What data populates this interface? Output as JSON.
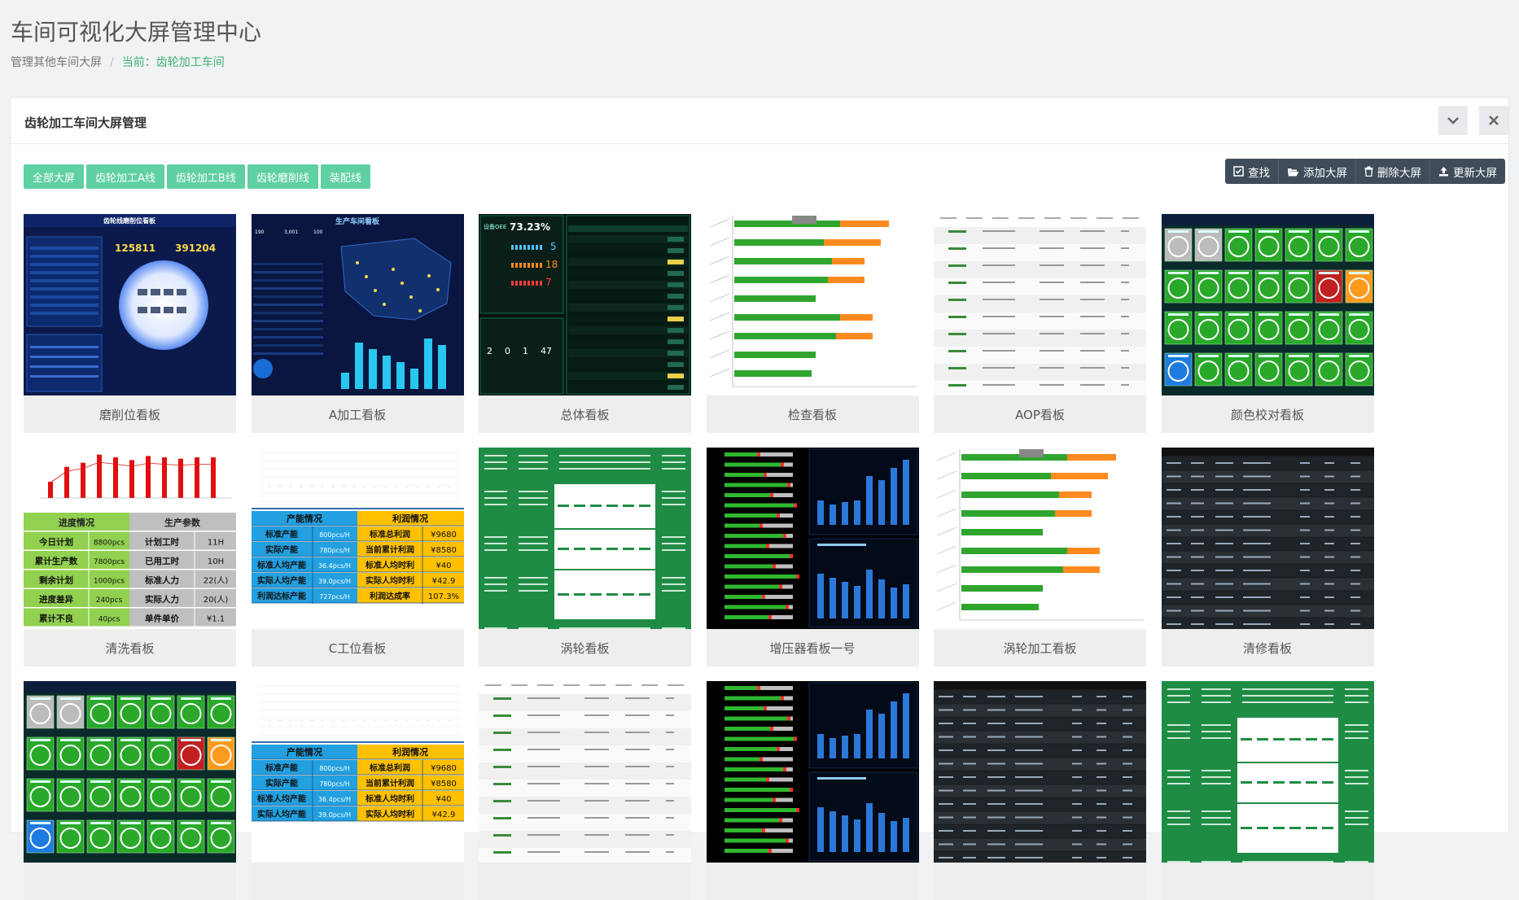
{
  "header": {
    "title": "车间可视化大屏管理中心",
    "breadcrumb": {
      "parent": "管理其他车间大屏",
      "current": "当前：齿轮加工车间"
    }
  },
  "panel": {
    "title": "齿轮加工车间大屏管理",
    "collapse_icon": "chevron-down-icon",
    "close_icon": "close-icon"
  },
  "filters": [
    "全部大屏",
    "齿轮加工A线",
    "齿轮加工B线",
    "齿轮磨削线",
    "装配线"
  ],
  "tools": [
    {
      "label": "查找",
      "icon": "search-check-icon"
    },
    {
      "label": "添加大屏",
      "icon": "folder-open-icon"
    },
    {
      "label": "删除大屏",
      "icon": "trash-icon"
    },
    {
      "label": "更新大屏",
      "icon": "upload-icon"
    }
  ],
  "cards": [
    {
      "label": "磨削位看板",
      "style": "navy-globe",
      "thumb_text": [
        "齿轮线磨削位看板",
        "125811",
        "391204"
      ]
    },
    {
      "label": "A加工看板",
      "style": "navy-map",
      "thumb_text": [
        "生产车间看板",
        "190",
        "3,001",
        "100"
      ]
    },
    {
      "label": "总体看板",
      "style": "black-metrics",
      "thumb_text": [
        "设备OEE",
        "73.23%",
        "5",
        "18",
        "7",
        "2",
        "0",
        "1",
        "47"
      ]
    },
    {
      "label": "检查看板",
      "style": "bars-green-orange",
      "thumb_text": []
    },
    {
      "label": "AOP看板",
      "style": "table-white",
      "thumb_text": []
    },
    {
      "label": "颜色校对看板",
      "style": "green-circles",
      "thumb_text": []
    },
    {
      "label": "清洗看板",
      "style": "qingxi-table",
      "thumb_text": [
        "进度情况",
        "生产参数",
        "今日计划",
        "8800pcs",
        "计划工时",
        "11H",
        "累计生产数",
        "7800pcs",
        "已用工时",
        "10H",
        "剩余计划",
        "1000pcs",
        "标准人力",
        "22(人)",
        "进度差异",
        "240pcs",
        "实际人力",
        "20(人)",
        "累计不良",
        "40pcs",
        "单件单价",
        "¥1.1"
      ]
    },
    {
      "label": "C工位看板",
      "style": "capacity-table",
      "thumb_text": [
        "产能情况",
        "利润情况",
        "标准产能",
        "800pcs/H",
        "标准总利润",
        "¥9680",
        "实际产能",
        "780pcs/H",
        "当前累计利润",
        "¥8580",
        "标准人均产能",
        "36.4pcs/H",
        "标准人均时利",
        "¥40",
        "实际人均产能",
        "39.0pcs/H",
        "实际人均时利",
        "¥42.9",
        "利润达标产能",
        "727pcs/H",
        "利润达成率",
        "107.3%"
      ]
    },
    {
      "label": "涡轮看板",
      "style": "green-matrix",
      "thumb_text": []
    },
    {
      "label": "增压器看板一号",
      "style": "black-bars-blue",
      "thumb_text": []
    },
    {
      "label": "涡轮加工看板",
      "style": "bars-green-orange",
      "thumb_text": []
    },
    {
      "label": "清修看板",
      "style": "dark-table",
      "thumb_text": []
    },
    {
      "label": "",
      "style": "green-circles",
      "thumb_text": []
    },
    {
      "label": "",
      "style": "capacity-table",
      "thumb_text": [
        "产能情况",
        "利润情况",
        "标准产能",
        "800pcs/H",
        "标准总利润",
        "¥9680",
        "实际产能",
        "780pcs/H",
        "当前累计利润",
        "¥8580",
        "标准人均产能",
        "36.4pcs/H",
        "标准人均时利",
        "¥40",
        "实际人均产能",
        "39.0pcs/H",
        "实际人均时利",
        "¥42.9"
      ]
    },
    {
      "label": "",
      "style": "table-white",
      "thumb_text": []
    },
    {
      "label": "",
      "style": "black-bars-blue",
      "thumb_text": []
    },
    {
      "label": "",
      "style": "dark-table",
      "thumb_text": []
    },
    {
      "label": "",
      "style": "green-matrix",
      "thumb_text": []
    }
  ],
  "colors": {
    "accent": "#5fd0a2",
    "toolbar": "#3f4d5a",
    "breadcrumb_current": "#3cb371"
  }
}
